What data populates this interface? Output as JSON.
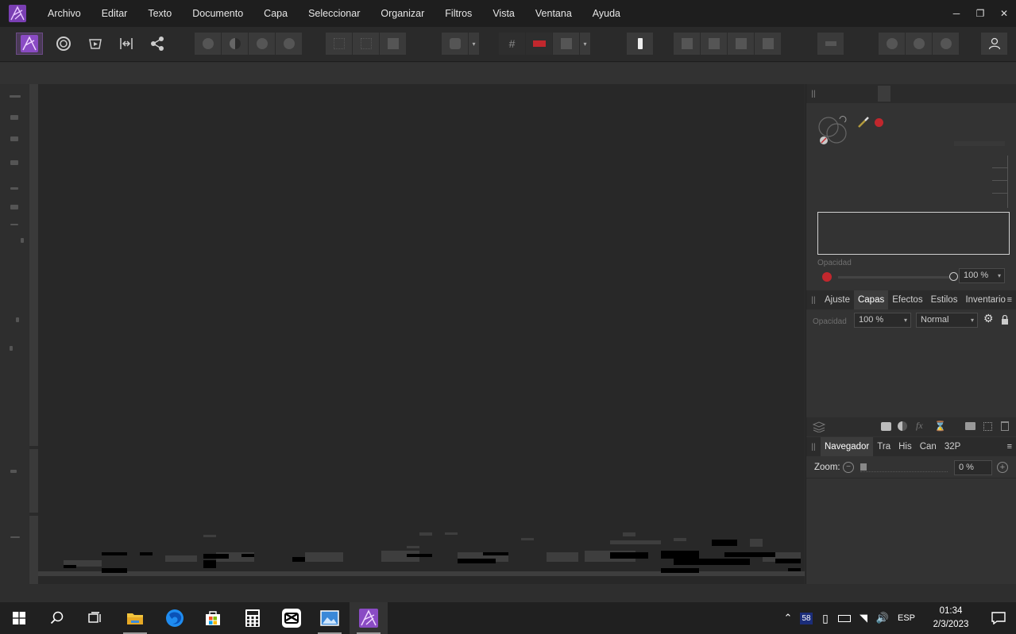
{
  "menubar": {
    "items": [
      "Archivo",
      "Editar",
      "Texto",
      "Documento",
      "Capa",
      "Seleccionar",
      "Organizar",
      "Filtros",
      "Vista",
      "Ventana",
      "Ayuda"
    ]
  },
  "colors": {
    "accent": "#b15fd8",
    "brand_logo": "#a86ad6",
    "recording_red": "#c1272d",
    "active_tab_bg": "#3c3c3c"
  },
  "personas": [
    "photo-persona-icon",
    "liquify-persona-icon",
    "develop-persona-icon",
    "tone-mapping-persona-icon",
    "export-persona-icon"
  ],
  "color_panel": {
    "opacity_label": "Opacidad",
    "opacity_value": "100 %"
  },
  "layers_panel": {
    "tabs": [
      "Ajuste",
      "Capas",
      "Efectos",
      "Estilos",
      "Inventario"
    ],
    "active_tab": "Capas",
    "opacity_label": "Opacidad",
    "opacity_value": "100 %",
    "blend_mode": "Normal"
  },
  "navigator_panel": {
    "tabs": [
      "Navegador",
      "Tra",
      "His",
      "Can",
      "32P"
    ],
    "active_tab": "Navegador",
    "zoom_label": "Zoom:",
    "zoom_value": "0 %"
  },
  "taskbar": {
    "tray_badge": "58",
    "language": "ESP",
    "time": "01:34",
    "date": "2/3/2023"
  }
}
